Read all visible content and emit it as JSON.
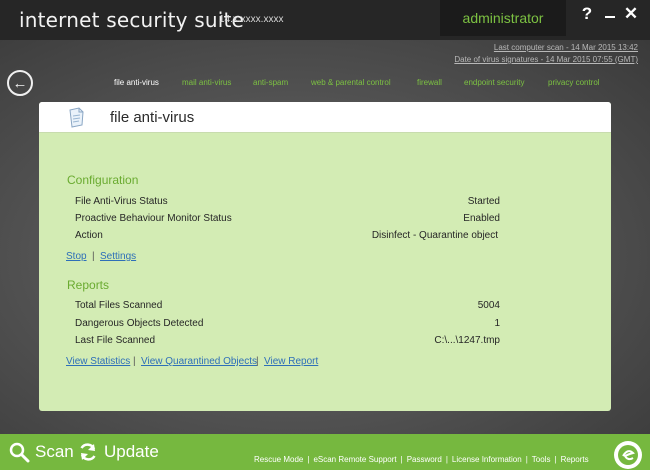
{
  "window": {
    "title": "internet security suite",
    "version": "14.x.xxxx.xxxx",
    "user": "administrator",
    "help_label": "?",
    "close_label": "✕"
  },
  "scan_info": {
    "last_scan": "Last computer scan - 14 Mar 2015 13:42",
    "signatures_date": "Date of  virus signatures - 14 Mar 2015 07:55 (GMT)"
  },
  "nav": {
    "items": [
      {
        "label": "file anti-virus",
        "active": true
      },
      {
        "label": "mail anti-virus",
        "active": false
      },
      {
        "label": "anti-spam",
        "active": false
      },
      {
        "label": "web & parental control",
        "active": false
      },
      {
        "label": "firewall",
        "active": false
      },
      {
        "label": "endpoint security",
        "active": false
      },
      {
        "label": "privacy control",
        "active": false
      }
    ]
  },
  "panel": {
    "title": "file anti-virus",
    "configuration": {
      "heading": "Configuration",
      "rows": [
        {
          "label": "File Anti-Virus Status",
          "value": "Started"
        },
        {
          "label": "Proactive Behaviour Monitor Status",
          "value": "Enabled"
        },
        {
          "label": "Action",
          "value": "Disinfect - Quarantine object"
        }
      ],
      "links": {
        "stop": "Stop",
        "separator": "|",
        "settings": "Settings"
      }
    },
    "reports": {
      "heading": "Reports",
      "rows": [
        {
          "label": "Total Files Scanned",
          "value": "5004"
        },
        {
          "label": "Dangerous Objects Detected",
          "value": "1"
        },
        {
          "label": "Last File Scanned",
          "value": "C:\\...\\1247.tmp"
        }
      ],
      "links": {
        "view_statistics": "View Statistics",
        "view_quarantined": "View Quarantined Objects",
        "view_report": "View Report",
        "separator": "|"
      }
    }
  },
  "bottom": {
    "scan_label": "Scan",
    "update_label": "Update",
    "footer_links": [
      "Rescue Mode",
      "eScan Remote Support",
      "Password",
      "License Information",
      "Tools",
      "Reports"
    ],
    "footer_separator": "|"
  },
  "colors": {
    "accent_green": "#7cc142",
    "panel_green": "#d3ecb4",
    "link_blue": "#2e6fb8",
    "bottom_bar": "#76b83f"
  }
}
